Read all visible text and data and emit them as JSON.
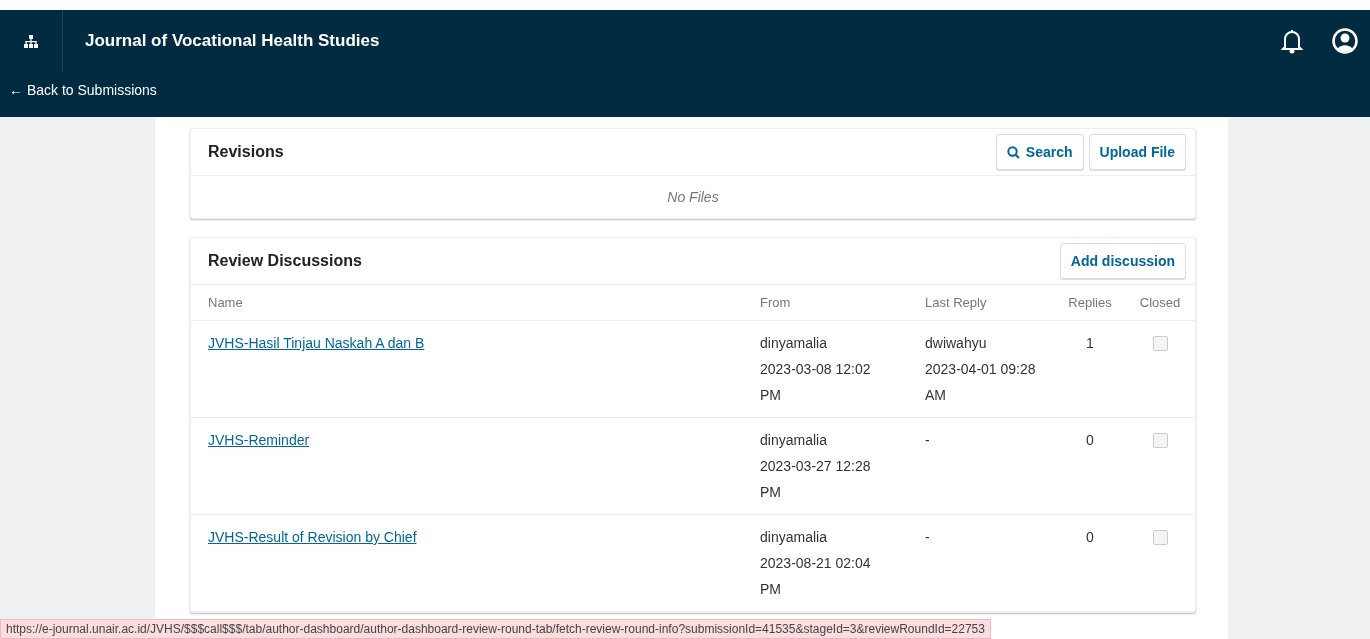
{
  "header": {
    "title": "Journal of Vocational Health Studies",
    "back_link": "← Back to Submissions"
  },
  "revisions": {
    "title": "Revisions",
    "buttons": [
      {
        "label": "Search",
        "kind": "search"
      },
      {
        "label": "Upload File",
        "kind": "plain"
      }
    ],
    "empty": "No Files"
  },
  "discussions": {
    "title": "Review Discussions",
    "button": "Add discussion",
    "columns": [
      "Name",
      "From",
      "Last Reply",
      "Replies",
      "Closed"
    ],
    "rows": [
      {
        "name": "JVHS-Hasil Tinjau Naskah A dan B",
        "from_user": "dinyamalia",
        "from_date": "2023-03-08 12:02 PM",
        "last_reply_user": "dwiwahyu",
        "last_reply_date": "2023-04-01 09:28 AM",
        "replies": "1",
        "closed": false
      },
      {
        "name": "JVHS-Reminder",
        "from_user": "dinyamalia",
        "from_date": "2023-03-27 12:28 PM",
        "last_reply_user": "-",
        "replies": "0",
        "closed": false
      },
      {
        "name": "JVHS-Result of Revision by Chief",
        "from_user": "dinyamalia",
        "from_date": "2023-08-21 02:04 PM",
        "last_reply_user": "-",
        "replies": "0",
        "closed": false
      }
    ]
  },
  "status_url": "https://e-journal.unair.ac.id/JVHS/$$$call$$$/tab/author-dashboard/author-dashboard-review-round-tab/fetch-review-round-info?submissionId=41535&stageId=3&reviewRoundId=22753"
}
